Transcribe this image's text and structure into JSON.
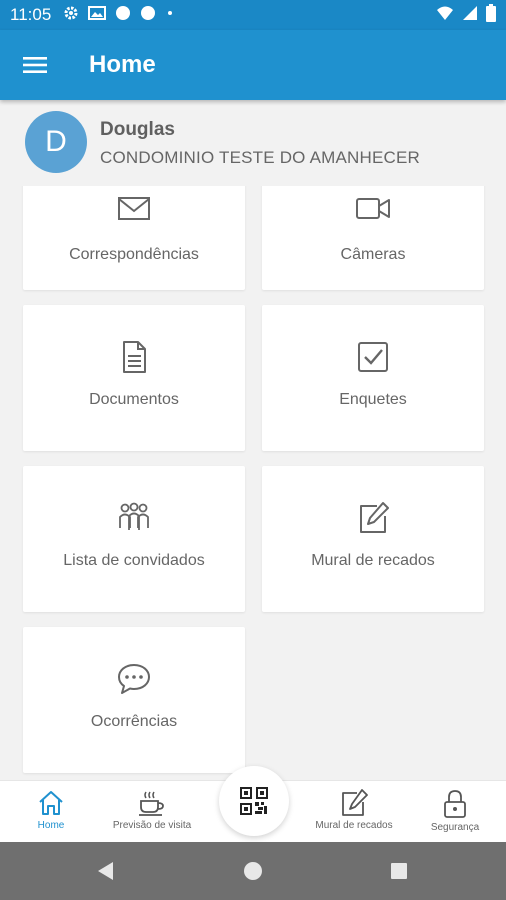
{
  "status_bar": {
    "time": "11:05",
    "left_icons": [
      "settings-icon",
      "photo-icon",
      "notification-dot-icon",
      "notification-dot-icon",
      "small-dot-icon"
    ],
    "right_icons": [
      "wifi-icon",
      "signal-icon",
      "battery-icon"
    ]
  },
  "appbar": {
    "title": "Home",
    "menu_icon": "hamburger-menu-icon",
    "color": "#1f91cf"
  },
  "profile": {
    "initial": "D",
    "name": "Douglas",
    "condo": "CONDOMINIO TESTE DO AMANHECER"
  },
  "menu": {
    "items": [
      {
        "label": "Correspondências",
        "icon": "envelope-icon"
      },
      {
        "label": "Câmeras",
        "icon": "video-camera-icon"
      },
      {
        "label": "Documentos",
        "icon": "document-icon"
      },
      {
        "label": "Enquetes",
        "icon": "checkbox-icon"
      },
      {
        "label": "Lista de convidados",
        "icon": "guests-icon"
      },
      {
        "label": "Mural de recados",
        "icon": "edit-note-icon"
      },
      {
        "label": "Ocorrências",
        "icon": "chat-bubble-icon"
      }
    ]
  },
  "bottom_nav": {
    "items": [
      {
        "label": "Home",
        "icon": "home-icon",
        "active": true
      },
      {
        "label": "Previsão de visita",
        "icon": "coffee-cup-icon",
        "active": false
      },
      {
        "label": "",
        "icon": "qr-code-icon",
        "active": false
      },
      {
        "label": "Mural de recados",
        "icon": "edit-note-icon",
        "active": false
      },
      {
        "label": "Segurança",
        "icon": "lock-icon",
        "active": false
      }
    ]
  },
  "system_nav": {
    "buttons": [
      "back-icon",
      "home-circle-icon",
      "recents-icon"
    ]
  },
  "colors": {
    "primary": "#1f91cf",
    "status_bar": "#1a88c6",
    "avatar": "#5aa2d4",
    "background": "#f2f2f2"
  }
}
